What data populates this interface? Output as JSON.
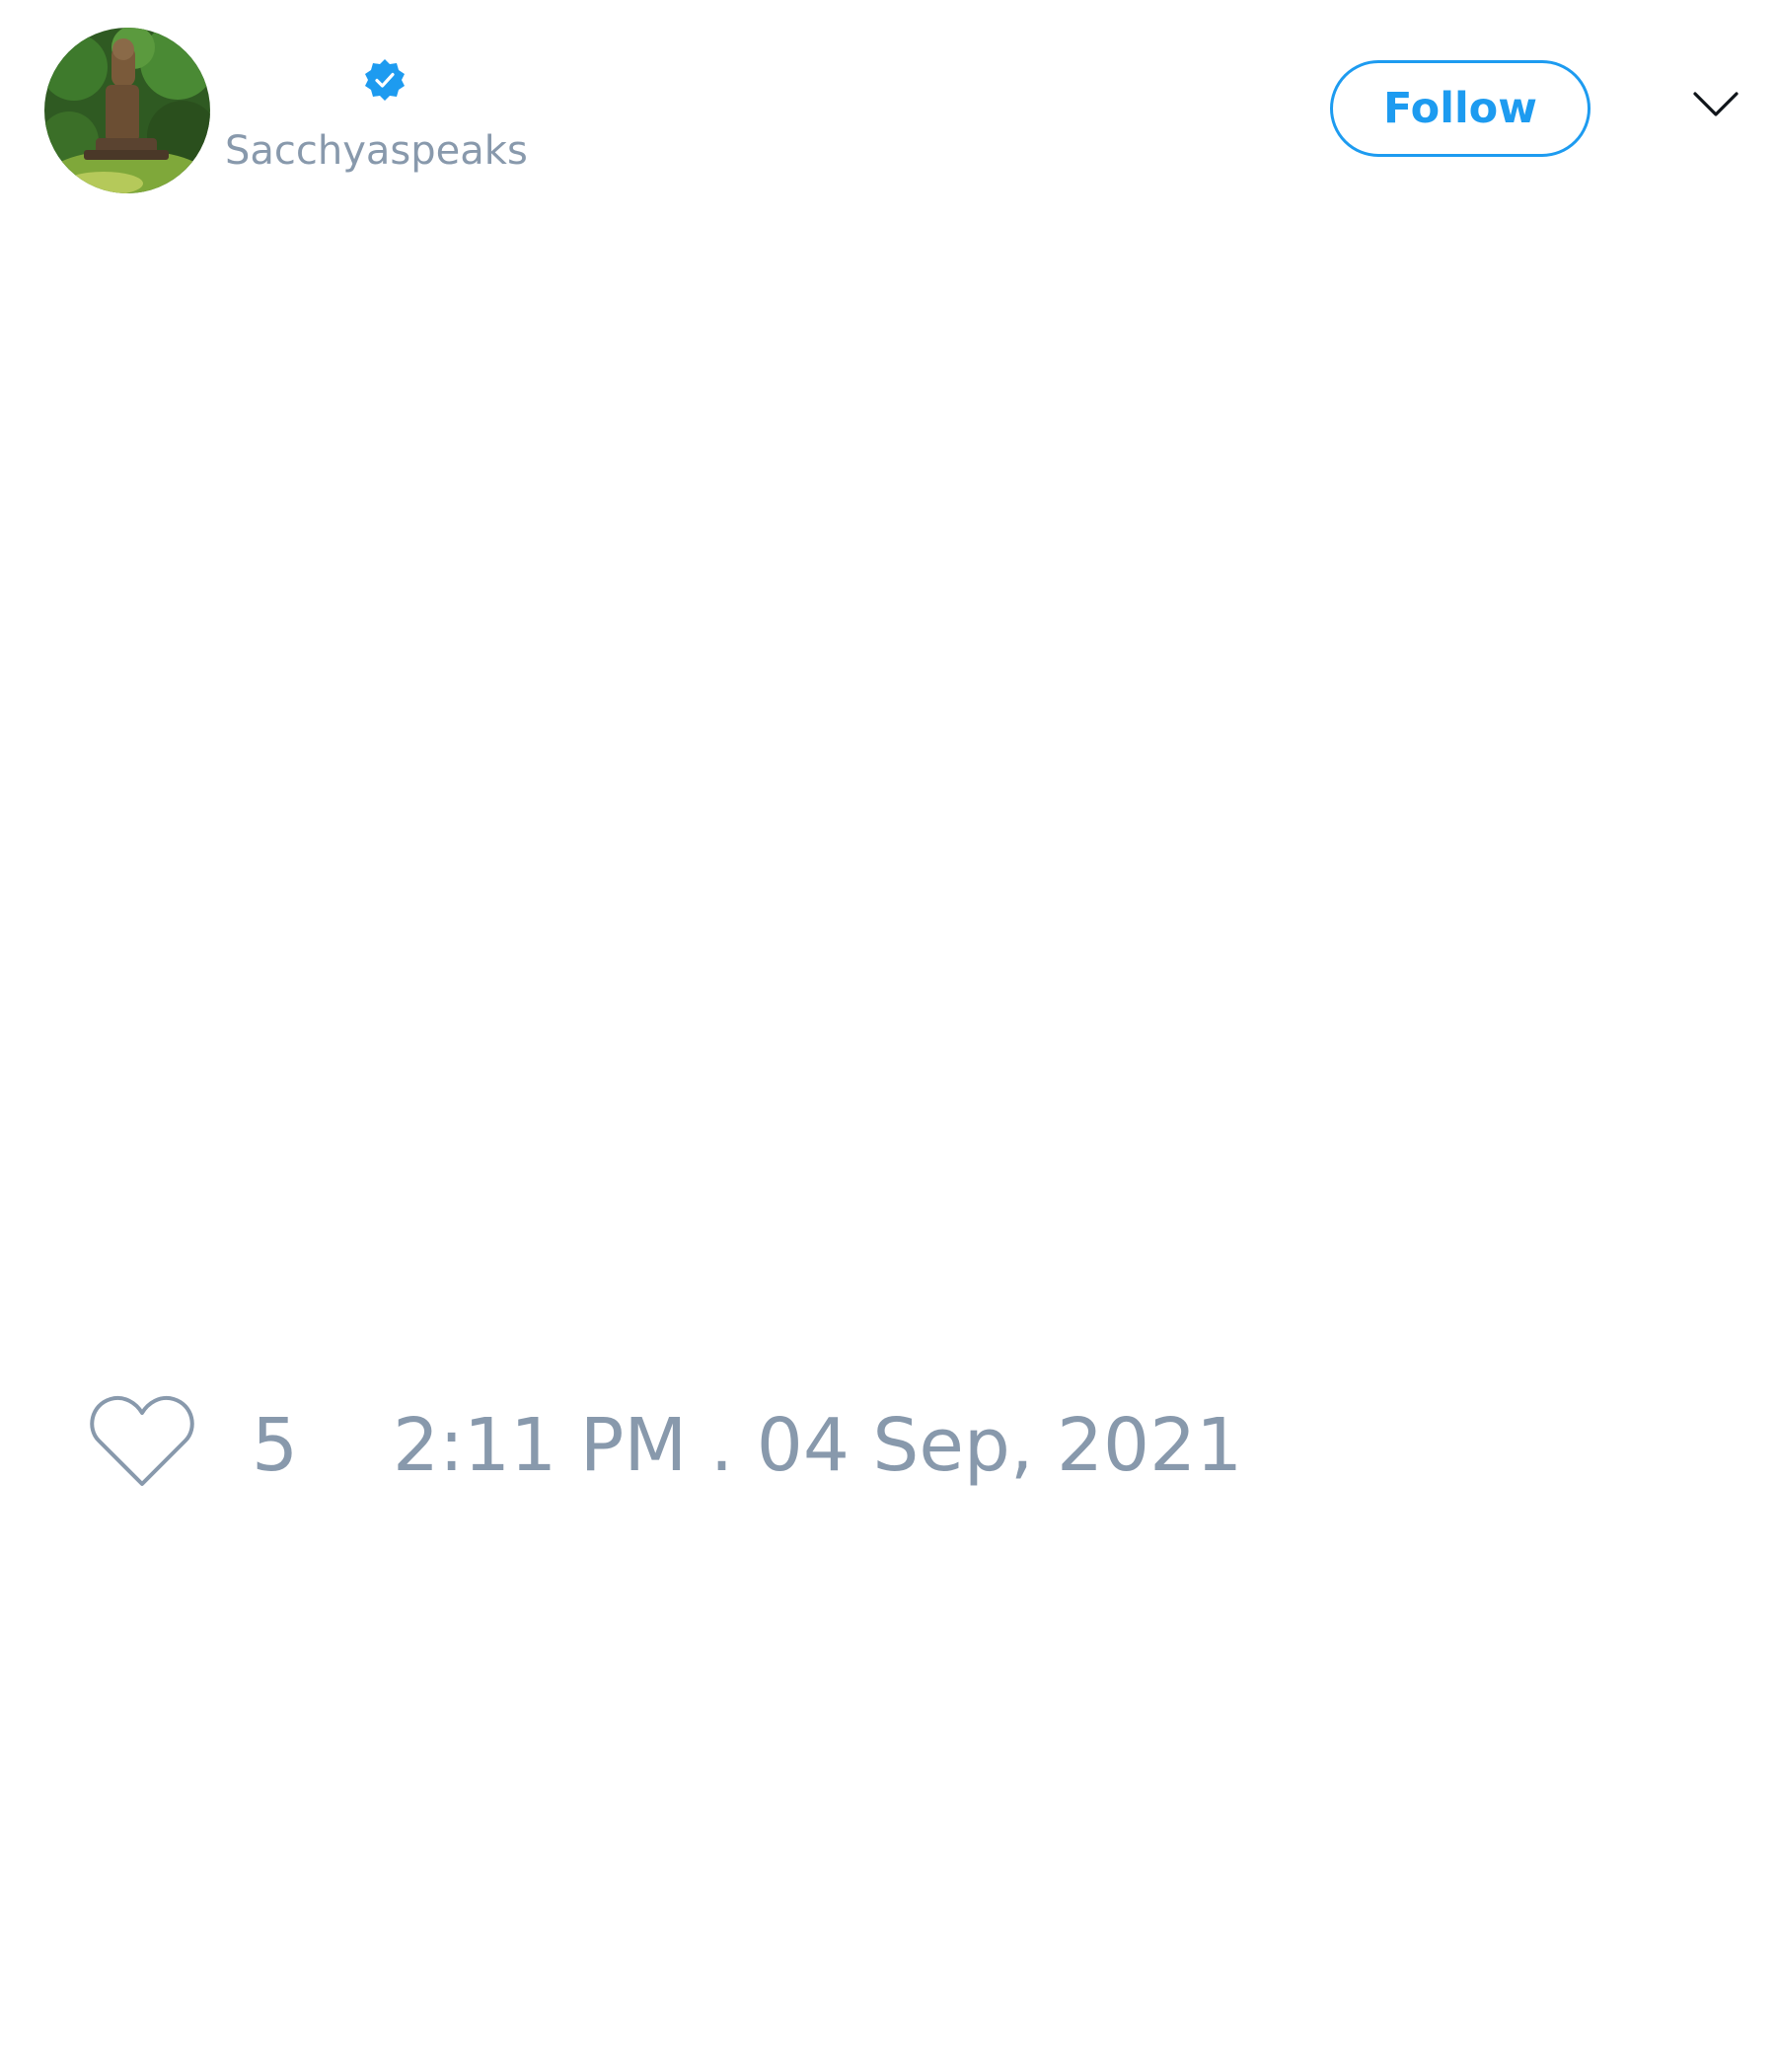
{
  "user": {
    "display_name": "",
    "handle": "Sacchyaspeaks",
    "verified": true,
    "avatar_icon": "profile-photo"
  },
  "header": {
    "follow_label": "Follow",
    "menu_icon": "chevron-down-icon"
  },
  "engagement": {
    "like_icon": "heart-icon",
    "like_count": "5",
    "timestamp": "2:11 PM . 04 Sep, 2021"
  },
  "colors": {
    "accent": "#1d9bf0",
    "muted_text": "#8899ac",
    "background": "#ffffff"
  }
}
